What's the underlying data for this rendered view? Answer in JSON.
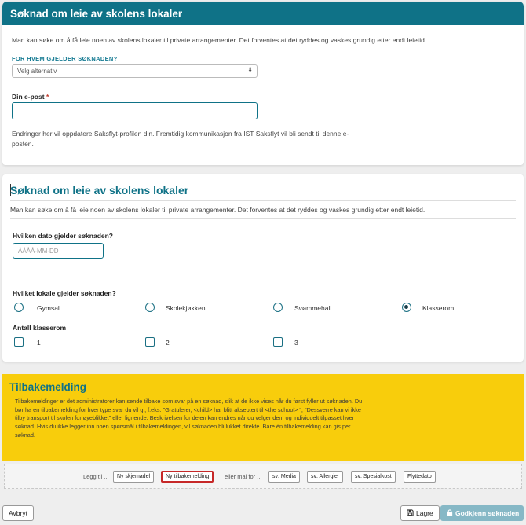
{
  "form1": {
    "title": "Søknad om leie av skolens lokaler",
    "description": "Man kan søke om å få leie noen av skolens lokaler til private arrangementer. Det forventes at det ryddes og vaskes grundig etter endt leietid.",
    "for_whom_label": "FOR HVEM GJELDER SØKNADEN?",
    "select_value": "Velg alternativ",
    "email_label": "Din e-post",
    "email_required_mark": "*",
    "email_value": "",
    "email_note": "Endringer her vil oppdatere Saksflyt-profilen din. Fremtidig kommunikasjon fra IST Saksflyt vil bli sendt til denne e-posten."
  },
  "form2": {
    "title": "Søknad om leie av skolens lokaler",
    "description": "Man kan søke om å få leie noen av skolens lokaler til private arrangementer. Det forventes at det ryddes og vaskes grundig etter endt leietid.",
    "date_label": "Hvilken dato gjelder søknaden?",
    "date_placeholder": "ÅÅÅÅ-MM-DD",
    "room_label": "Hvilket lokale gjelder søknaden?",
    "rooms": [
      {
        "label": "Gymsal",
        "checked": false
      },
      {
        "label": "Skolekjøkken",
        "checked": false
      },
      {
        "label": "Svømmehall",
        "checked": false
      },
      {
        "label": "Klasserom",
        "checked": true
      }
    ],
    "classrooms_label": "Antall klasserom",
    "classrooms": [
      {
        "label": "1",
        "checked": false
      },
      {
        "label": "2",
        "checked": false
      },
      {
        "label": "3",
        "checked": false
      }
    ]
  },
  "feedback": {
    "title": "Tilbakemelding",
    "text": "Tilbakemeldinger er det administratorer kan sende tilbake som svar på en søknad, slik at de ikke vises når du først fyller ut søknaden. Du bør ha en tilbakemelding for hver type svar du vil gi, f.eks. \"Gratulerer, <child> har blitt akseptert til <the school> \", \"Dessverre kan vi ikke tilby transport til skolen for øyeblikket\" eller lignende. Beskrivelsen for delen kan endres når du velger den, og individuelt tilpasset hver søknad. Hvis du ikke legger inn noen spørsmål i tilbakemeldingen, vil søknaden bli lukket direkte. Bare én tilbakemelding kan gis per søknad."
  },
  "insert_bar": {
    "prefix": "Legg til ...",
    "new_form": "Ny skjemadel",
    "new_feedback": "Ny tilbakemelding",
    "or_template": "eller mal for ...",
    "templates": [
      "sv: Media",
      "sv: Allergier",
      "sv: Spesialkost",
      "Flyttedato"
    ]
  },
  "buttons": {
    "cancel": "Avbryt",
    "save": "Lagre",
    "approve": "Godkjenn søknaden"
  },
  "colors": {
    "primary": "#0f7287",
    "feedback_bg": "#f8cd0c",
    "highlight": "#c62828",
    "approve_bg": "#86b8c6"
  }
}
